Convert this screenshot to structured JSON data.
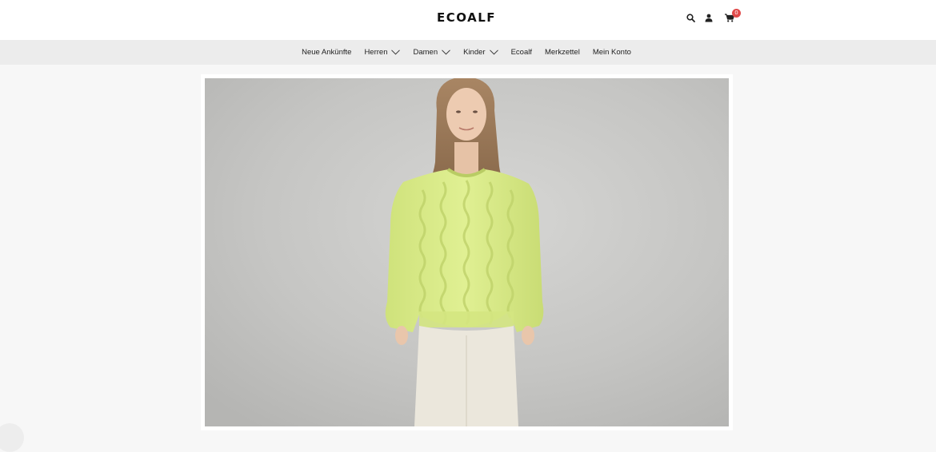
{
  "header": {
    "logo": "ECOALF",
    "cart_count": "0",
    "icons": [
      "search-icon",
      "user-icon",
      "cart-icon"
    ]
  },
  "nav": {
    "items": [
      {
        "label": "Neue Ankünfte",
        "dropdown": false
      },
      {
        "label": "Herren",
        "dropdown": true
      },
      {
        "label": "Damen",
        "dropdown": true
      },
      {
        "label": "Kinder",
        "dropdown": true
      },
      {
        "label": "Ecoalf",
        "dropdown": false
      },
      {
        "label": "Merkzettel",
        "dropdown": false
      },
      {
        "label": "Mein Konto",
        "dropdown": false
      }
    ]
  },
  "hero": {
    "image": "woman-in-lime-cable-knit-sweater-photo"
  },
  "colors": {
    "header_bg": "#ffffff",
    "nav_bg": "#ececec",
    "page_bg": "#f7f7f7",
    "badge": "#e04b4b",
    "sweater": "#dbed8c"
  }
}
